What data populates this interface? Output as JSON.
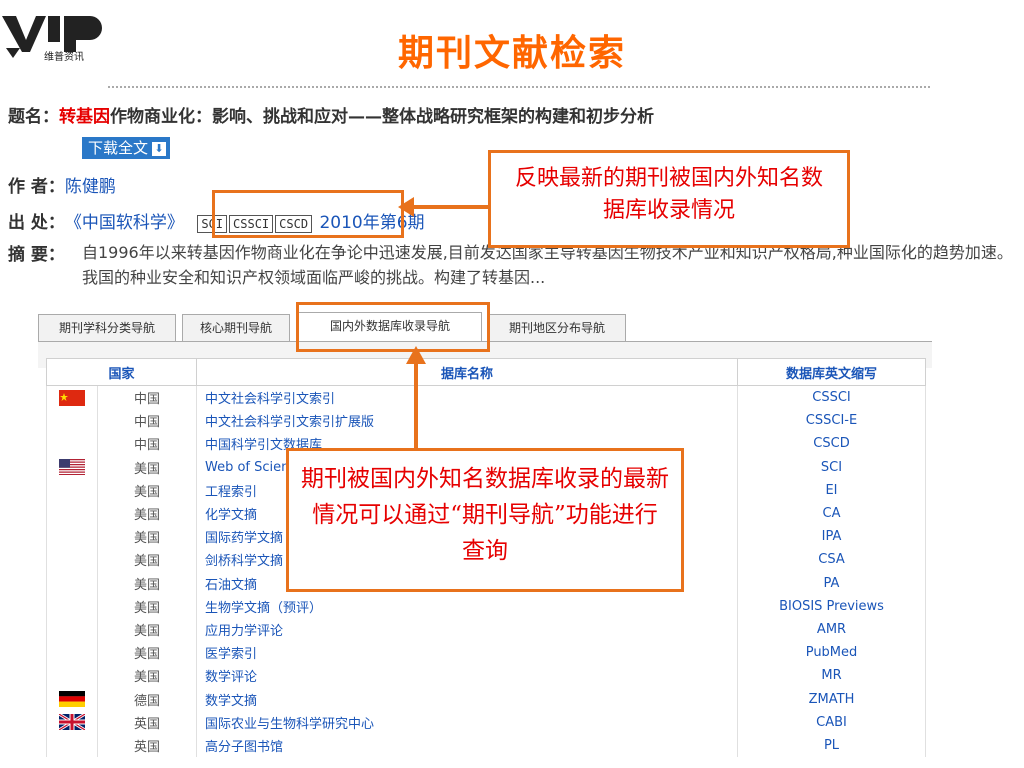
{
  "header": {
    "logo_text": "VIP",
    "logo_sub": "维普资讯",
    "page_title": "期刊文献检索"
  },
  "record": {
    "title_label": "题名：",
    "title_highlight": "转基因",
    "title_rest": "作物商业化：影响、挑战和应对——整体战略研究框架的构建和初步分析",
    "download_label": "下载全文",
    "author_label": "作 者：",
    "author": "陈健鹏",
    "source_label": "出 处：",
    "source_journal": "《中国软科学》",
    "indexes": [
      "SCI",
      "CSSCI",
      "CSCD"
    ],
    "source_issue": "2010年第6期",
    "abstract_label": "摘 要：",
    "abstract": "自1996年以来转基因作物商业化在争论中迅速发展,目前发达国家主导转基因生物技术产业和知识产权格局,种业国际化的趋势加速。我国的种业安全和知识产权领域面临严峻的挑战。构建了转基因..."
  },
  "callouts": {
    "top": "反映最新的期刊被国内外知名数据库收录情况",
    "middle": "期刊被国内外知名数据库收录的最新情况可以通过“期刊导航”功能进行查询"
  },
  "tabs": [
    {
      "label": "期刊学科分类导航"
    },
    {
      "label": "核心期刊导航"
    },
    {
      "label": "国内外数据库收录导航"
    },
    {
      "label": "期刊地区分布导航"
    }
  ],
  "table": {
    "headers": [
      "国家",
      "据库名称",
      "数据库英文缩写"
    ],
    "rows": [
      {
        "flag": "cn",
        "country": "中国",
        "name": "中文社会科学引文索引",
        "abbr": "CSSCI"
      },
      {
        "flag": "",
        "country": "中国",
        "name": "中文社会科学引文索引扩展版",
        "abbr": "CSSCI-E"
      },
      {
        "flag": "",
        "country": "中国",
        "name": "中国科学引文数据库",
        "abbr": "CSCD"
      },
      {
        "flag": "us",
        "country": "美国",
        "name": "Web of Science",
        "abbr": "SCI"
      },
      {
        "flag": "",
        "country": "美国",
        "name": "工程索引",
        "abbr": "EI"
      },
      {
        "flag": "",
        "country": "美国",
        "name": "化学文摘",
        "abbr": "CA"
      },
      {
        "flag": "",
        "country": "美国",
        "name": "国际药学文摘",
        "abbr": "IPA"
      },
      {
        "flag": "",
        "country": "美国",
        "name": "剑桥科学文摘",
        "abbr": "CSA"
      },
      {
        "flag": "",
        "country": "美国",
        "name": "石油文摘",
        "abbr": "PA"
      },
      {
        "flag": "",
        "country": "美国",
        "name": "生物学文摘（预评）",
        "abbr": "BIOSIS Previews"
      },
      {
        "flag": "",
        "country": "美国",
        "name": "应用力学评论",
        "abbr": "AMR"
      },
      {
        "flag": "",
        "country": "美国",
        "name": "医学索引",
        "abbr": "PubMed"
      },
      {
        "flag": "",
        "country": "美国",
        "name": "数学评论",
        "abbr": "MR"
      },
      {
        "flag": "de",
        "country": "德国",
        "name": "数学文摘",
        "abbr": "ZMATH"
      },
      {
        "flag": "gb",
        "country": "英国",
        "name": "国际农业与生物科学研究中心",
        "abbr": "CABI"
      },
      {
        "flag": "",
        "country": "英国",
        "name": "高分子图书馆",
        "abbr": "PL"
      }
    ]
  },
  "colors": {
    "accent": "#e8721c",
    "title": "#ff6600",
    "link": "#1a55b8",
    "highlight": "#e60000"
  }
}
